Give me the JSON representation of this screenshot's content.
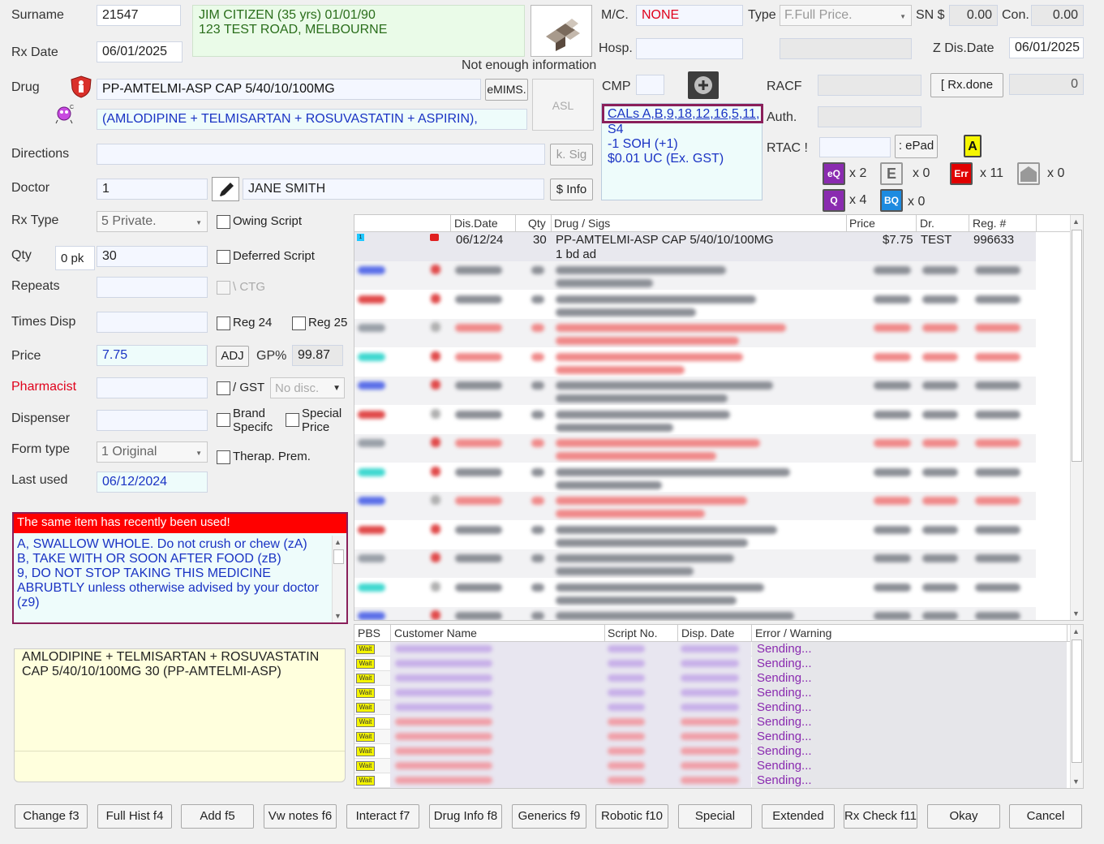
{
  "patient": {
    "surname_label": "Surname",
    "surname_value": "21547",
    "name_line": "JIM CITIZEN  (35 yrs) 01/01/90",
    "address_line": "123 TEST ROAD, MELBOURNE",
    "info_note": "Not enough information",
    "rx_date_label": "Rx Date",
    "rx_date_value": "06/01/2025"
  },
  "right_top": {
    "mc_label": "M/C.",
    "mc_value": "NONE",
    "type_label": "Type",
    "type_value": "F.Full Price.",
    "sn_label": "SN $",
    "sn_value": "0.00",
    "con_label": "Con.",
    "con_value": "0.00",
    "hosp_label": "Hosp.",
    "zdis_label": "Z Dis.Date",
    "zdis_value": "06/01/2025",
    "cmp_label": "CMP",
    "racf_label": "RACF",
    "rxdone_label": "[ Rx.done",
    "rxdone_count": "0",
    "auth_label": "Auth.",
    "rtac_label": "RTAC !",
    "epad_label": ": ePad",
    "asl_label": "ASL"
  },
  "cals": {
    "line1": "CALs A,B,9,18,12,16,5,11,",
    "line2": "S4",
    "line3": "-1 SOH (+1)",
    "line4": "$0.01 UC (Ex. GST)"
  },
  "badges": {
    "a_label": "A",
    "eq_label": "eQ",
    "eq_count": "x 2",
    "e_label": "E",
    "e_count": "x 0",
    "err_label": "Err",
    "err_count": "x 11",
    "home_count": "x 0",
    "q_label": "Q",
    "q_count": "x 4",
    "bq_label": "BQ",
    "bq_count": "x 0"
  },
  "drug": {
    "drug_label": "Drug",
    "drug_value": "PP-AMTELMI-ASP CAP 5/40/10/100MG",
    "emims_label": "eMIMS.",
    "generic_value": "(AMLODIPINE + TELMISARTAN + ROSUVASTATIN + ASPIRIN),",
    "directions_label": "Directions",
    "ksig_label": "k. Sig",
    "doctor_label": "Doctor",
    "doctor_code": "1",
    "doctor_name": "JANE SMITH",
    "sinfo_label": "$ Info"
  },
  "form": {
    "rx_type_label": "Rx Type",
    "rx_type_value": "5 Private.",
    "owing_label": "Owing Script",
    "qty_label": "Qty",
    "pk_value": "0 pk",
    "qty_value": "30",
    "deferred_label": "Deferred Script",
    "repeats_label": "Repeats",
    "ctg_label": "\\ CTG",
    "times_disp_label": "Times Disp",
    "reg24_label": "Reg 24",
    "reg25_label": "Reg 25",
    "price_label": "Price",
    "price_value": "7.75",
    "adj_label": "ADJ",
    "gp_label": "GP%",
    "gp_value": "99.87",
    "pharmacist_label": "Pharmacist",
    "gst_label": "/ GST",
    "disc_value": "No disc.",
    "dispenser_label": "Dispenser",
    "brand_label_1": "Brand",
    "brand_label_2": "Specifc",
    "special_price_1": "Special",
    "special_price_2": "Price",
    "form_type_label": "Form type",
    "form_type_value": "1 Original",
    "therap_label": "Therap. Prem.",
    "last_used_label": "Last used",
    "last_used_value": "06/12/2024"
  },
  "warning": {
    "title": "The same item has recently been used!",
    "line1": "A,    SWALLOW WHOLE. Do not crush or chew (zA)",
    "line2": "B,    TAKE WITH OR SOON AFTER FOOD (zB)",
    "line3": "9,    DO NOT STOP TAKING THIS MEDICINE",
    "line4": "ABRUBTLY unless otherwise advised by your doctor",
    "line5": "(z9)"
  },
  "label_preview": {
    "line1": "AMLODIPINE + TELMISARTAN + ROSUVASTATIN",
    "line2": "CAP 5/40/10/100MG 30 (PP-AMTELMI-ASP)"
  },
  "history": {
    "headers": [
      "Dis.Date",
      "Qty",
      "Drug / Sigs",
      "Price",
      "Dr.",
      "Reg. #"
    ],
    "first_row": {
      "date": "06/12/24",
      "qty": "30",
      "drug": "PP-AMTELMI-ASP CAP 5/40/10/100MG",
      "sig": "1 bd ad",
      "price": "$7.75",
      "dr": "TEST",
      "reg": "996633"
    }
  },
  "queue": {
    "headers": [
      "PBS",
      "Customer Name",
      "Script No.",
      "Disp. Date",
      "Error / Warning"
    ],
    "status_rows": [
      "Sending...",
      "Sending...",
      "Sending...",
      "Sending...",
      "Sending...",
      "Sending...",
      "Sending...",
      "Sending...",
      "Sending...",
      "Sending..."
    ],
    "wait_label": "Wait"
  },
  "buttons": {
    "change": "Change f3",
    "full_hist": "Full Hist f4",
    "add": "Add   f5",
    "vw_notes": "Vw notes f6",
    "interact": "Interact f7",
    "drug_info": "Drug Info f8",
    "generics": "Generics f9",
    "robotic": "Robotic f10",
    "special": "Special",
    "extended": "Extended",
    "rx_check": "Rx Check f11",
    "okay": "Okay",
    "cancel": "Cancel"
  }
}
